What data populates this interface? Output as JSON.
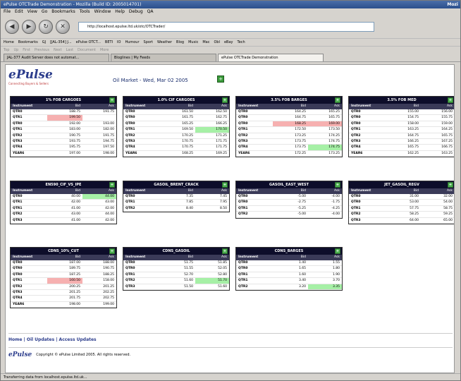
{
  "window": {
    "title": "ePulse OTCTrade Demonstration - Mozilla (Build ID: 2005014701)",
    "brand": "Mozi"
  },
  "menu": [
    "File",
    "Edit",
    "View",
    "Go",
    "Bookmarks",
    "Tools",
    "Window",
    "Help",
    "Debug",
    "QA"
  ],
  "url": "http://localhost.epulse.ltd.uk/otc/OTCTrader/",
  "bookmarks": [
    "Home",
    "Bookmarks",
    "GJ",
    "[JAL-354] J...",
    "ePulse OTCT...",
    "BETI",
    "IO",
    "Humour",
    "Sport",
    "Weather",
    "Blog",
    "Music",
    "Mac",
    "Obl",
    "eBay",
    "Tech"
  ],
  "subbar": [
    "Top",
    "Up",
    "First",
    "Previous",
    "Next",
    "Last",
    "Document",
    "More"
  ],
  "tabs": [
    {
      "label": "JAL-377 Audit Server does not automat..."
    },
    {
      "label": "Bloglines | My Feeds"
    },
    {
      "label": "ePulse OTCTrade Demonstration"
    }
  ],
  "page": {
    "logo": "ePulse",
    "logo_tag": "Connecting Buyers & Sellers",
    "title": "Oil Market  -  Wed, Mar 02 2005",
    "refresh_icon": "+"
  },
  "columns": [
    "Instrument",
    "Bid",
    "Ask"
  ],
  "panels": [
    {
      "title": "1% FOB CARGOES",
      "rows": [
        [
          "QTR0",
          "188.75",
          "191.75",
          "",
          ""
        ],
        [
          "QTR1",
          "199.50",
          "",
          "dn",
          ""
        ],
        [
          "QTR0",
          "192.00",
          "193.00",
          "",
          ""
        ],
        [
          "QTR1",
          "183.00",
          "182.00",
          "",
          ""
        ],
        [
          "QTR2",
          "190.75",
          "191.75",
          "",
          ""
        ],
        [
          "QTR3",
          "193.75",
          "194.75",
          "",
          ""
        ],
        [
          "QTR4",
          "195.75",
          "197.50",
          "",
          ""
        ],
        [
          "YEAR6",
          "197.00",
          "198.00",
          "",
          ""
        ]
      ]
    },
    {
      "title": "1.0% CIF CARGOES",
      "rows": [
        [
          "QTR0",
          "161.50",
          "162.50",
          "",
          ""
        ],
        [
          "QTR0",
          "161.75",
          "162.75",
          "",
          ""
        ],
        [
          "QTR0",
          "165.25",
          "166.25",
          "",
          ""
        ],
        [
          "QTR1",
          "169.50",
          "170.50",
          "",
          "up"
        ],
        [
          "QTR2",
          "170.25",
          "171.25",
          "",
          ""
        ],
        [
          "QTR3",
          "170.75",
          "171.75",
          "",
          ""
        ],
        [
          "QTR4",
          "170.75",
          "171.75",
          "",
          ""
        ],
        [
          "YEAR6",
          "168.25",
          "169.25",
          "",
          ""
        ]
      ]
    },
    {
      "title": "3.5% FOB BARGES",
      "rows": [
        [
          "QTR0",
          "164.25",
          "165.25",
          "",
          ""
        ],
        [
          "QTR0",
          "164.75",
          "165.75",
          "",
          ""
        ],
        [
          "QTR0",
          "168.25",
          "169.00",
          "dn",
          "dn"
        ],
        [
          "QTR1",
          "172.50",
          "173.50",
          "",
          ""
        ],
        [
          "QTR2",
          "173.25",
          "174.25",
          "",
          ""
        ],
        [
          "QTR3",
          "173.75",
          "174.75",
          "",
          ""
        ],
        [
          "QTR4",
          "173.75",
          "174.75",
          "",
          "up"
        ],
        [
          "YEAR6",
          "172.25",
          "173.25",
          "",
          ""
        ]
      ]
    },
    {
      "title": "3.5% FOB MED",
      "rows": [
        [
          "QTR0",
          "155.00",
          "156.00",
          "",
          ""
        ],
        [
          "QTR0",
          "154.75",
          "155.75",
          "",
          ""
        ],
        [
          "QTR0",
          "158.00",
          "159.00",
          "",
          ""
        ],
        [
          "QTR1",
          "163.25",
          "164.25",
          "",
          ""
        ],
        [
          "QTR2",
          "164.75",
          "165.75",
          "",
          ""
        ],
        [
          "QTR3",
          "166.25",
          "167.25",
          "",
          ""
        ],
        [
          "QTR4",
          "165.75",
          "166.75",
          "",
          ""
        ],
        [
          "YEAR6",
          "162.25",
          "163.25",
          "",
          ""
        ]
      ]
    },
    {
      "title": "EN590_CIF_VS_IPE",
      "rows": [
        [
          "QTR0",
          "40.00",
          "44.00",
          "",
          "up"
        ],
        [
          "QTR1",
          "42.00",
          "43.00",
          "",
          ""
        ],
        [
          "QTR1",
          "41.00",
          "42.00",
          "",
          ""
        ],
        [
          "QTR2",
          "43.00",
          "44.00",
          "",
          ""
        ],
        [
          "QTR3",
          "41.00",
          "42.00",
          "",
          ""
        ]
      ]
    },
    {
      "title": "GASOIL_BRENT_CRACK",
      "rows": [
        [
          "QTR0",
          "7.35",
          "7.45",
          "",
          ""
        ],
        [
          "QTR1",
          "7.85",
          "7.95",
          "",
          ""
        ],
        [
          "QTR2",
          "8.40",
          "8.50",
          "",
          ""
        ]
      ]
    },
    {
      "title": "GASOIL_EAST_WEST",
      "rows": [
        [
          "QTR0",
          "-5.00",
          "-4.00",
          "",
          ""
        ],
        [
          "QTR0",
          "-2.75",
          "-1.75",
          "",
          ""
        ],
        [
          "QTR1",
          "-5.25",
          "-4.25",
          "",
          ""
        ],
        [
          "QTR2",
          "-5.00",
          "-4.00",
          "",
          ""
        ]
      ]
    },
    {
      "title": "JET_GASOIL_REGV",
      "rows": [
        [
          "QTR0",
          "31.00",
          "32.00",
          "",
          ""
        ],
        [
          "QTR0",
          "53.00",
          "54.00",
          "",
          ""
        ],
        [
          "QTR1",
          "57.75",
          "58.75",
          "",
          ""
        ],
        [
          "QTR2",
          "58.25",
          "59.25",
          "",
          ""
        ],
        [
          "QTR3",
          "64.00",
          "65.00",
          "",
          ""
        ]
      ]
    },
    {
      "title": "CDNS_10%_CUT",
      "rows": [
        [
          "QTR0",
          "187.00",
          "188.00",
          "",
          ""
        ],
        [
          "QTR0",
          "189.75",
          "190.75",
          "",
          ""
        ],
        [
          "QTR0",
          "187.25",
          "188.25",
          "",
          ""
        ],
        [
          "QTR1",
          "160.50",
          "158.00",
          "dn",
          ""
        ],
        [
          "QTR2",
          "200.25",
          "201.25",
          "",
          ""
        ],
        [
          "QTR3",
          "201.25",
          "202.25",
          "",
          ""
        ],
        [
          "QTR4",
          "201.75",
          "202.75",
          "",
          ""
        ],
        [
          "YEAR6",
          "198.00",
          "199.00",
          "",
          ""
        ]
      ]
    },
    {
      "title": "CDNS_GASOIL",
      "rows": [
        [
          "QTR0",
          "51.75",
          "51.85",
          "",
          ""
        ],
        [
          "QTR0",
          "51.55",
          "52.05",
          "",
          ""
        ],
        [
          "QTR1",
          "52.70",
          "52.80",
          "",
          ""
        ],
        [
          "QTR2",
          "51.60",
          "51.70",
          "",
          "up"
        ],
        [
          "QTR3",
          "51.50",
          "51.60",
          "",
          ""
        ]
      ]
    },
    {
      "title": "CDNS_BARGES",
      "rows": [
        [
          "QTR0",
          "1.40",
          "1.55",
          "",
          ""
        ],
        [
          "QTR0",
          "1.65",
          "1.80",
          "",
          ""
        ],
        [
          "QTR1",
          "1.60",
          "1.90",
          "",
          ""
        ],
        [
          "QTR1",
          "3.40",
          "3.70",
          "",
          ""
        ],
        [
          "QTR2",
          "3.20",
          "3.35",
          "",
          "up"
        ]
      ]
    }
  ],
  "footer": {
    "links": [
      "Home",
      "Oil Updates",
      "Access Updates"
    ],
    "copyright": "Copyright © ePulse Limited 2005. All rights reserved.",
    "mini_logo": "ePulse"
  },
  "status": "Transferring data from localhost.epulse.ltd.uk..."
}
